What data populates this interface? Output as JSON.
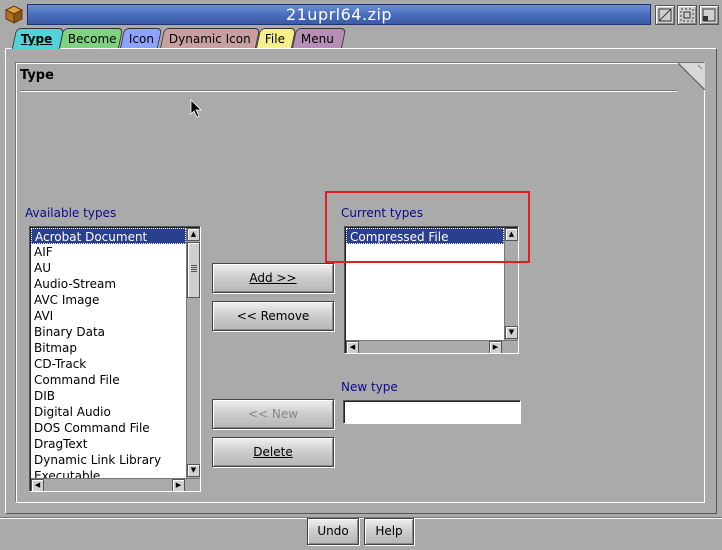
{
  "window": {
    "title": "21uprl64.zip",
    "icon": "package-icon"
  },
  "tabs": [
    {
      "label": "Type",
      "color": "#52d3d8",
      "active": true
    },
    {
      "label": "Become",
      "color": "#7fd27f"
    },
    {
      "label": "Icon",
      "color": "#8ea3ff"
    },
    {
      "label": "Dynamic Icon",
      "color": "#c9a0a0"
    },
    {
      "label": "File",
      "color": "#f5f08a"
    },
    {
      "label": "Menu",
      "color": "#b68fb6"
    }
  ],
  "group": {
    "title": "Type"
  },
  "available": {
    "label": "Available types",
    "items": [
      "Acrobat Document",
      "AIF",
      "AU",
      "Audio-Stream",
      "AVC Image",
      "AVI",
      "Binary Data",
      "Bitmap",
      "CD-Track",
      "Command File",
      "DIB",
      "Digital Audio",
      "DOS Command File",
      "DragText",
      "Dynamic Link Library",
      "Executable"
    ],
    "selected_index": 0
  },
  "current": {
    "label": "Current types",
    "items": [
      "Compressed File"
    ],
    "selected_index": 0
  },
  "new_type": {
    "label": "New type",
    "value": ""
  },
  "buttons": {
    "add": "Add >>",
    "remove": "<< Remove",
    "new": "<< New",
    "delete": "Delete",
    "undo": "Undo",
    "help": "Help"
  },
  "colors": {
    "title_gradient": "#4a6fbe",
    "selection": "#2b3f8f",
    "label": "#0a0a8a",
    "highlight": "#e02020"
  }
}
